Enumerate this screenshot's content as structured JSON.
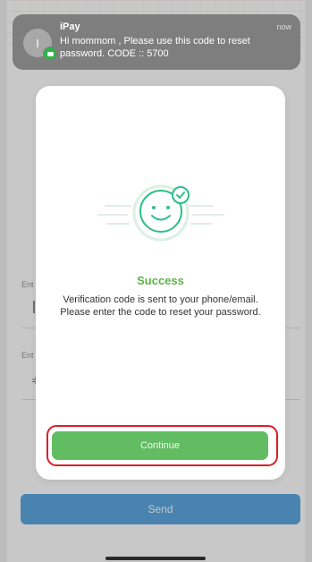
{
  "notification": {
    "app_name": "iPay",
    "time": "now",
    "avatar_initial": "I",
    "message": "Hi mommom , Please use this code to reset password. CODE :: 5700"
  },
  "background_form": {
    "field1_label": "Ent",
    "field2_label": "Ent",
    "field2_glyph": "≑",
    "send_label": "Send"
  },
  "dialog": {
    "icon": "smiley-check-icon",
    "title": "Success",
    "message": "Verification code is sent to your phone/email. Please enter the code to reset your password.",
    "continue_label": "Continue"
  },
  "colors": {
    "success_green": "#5db449",
    "button_green": "#62bd62",
    "send_blue": "#5aa2d8",
    "highlight_red": "#d81f2a"
  }
}
